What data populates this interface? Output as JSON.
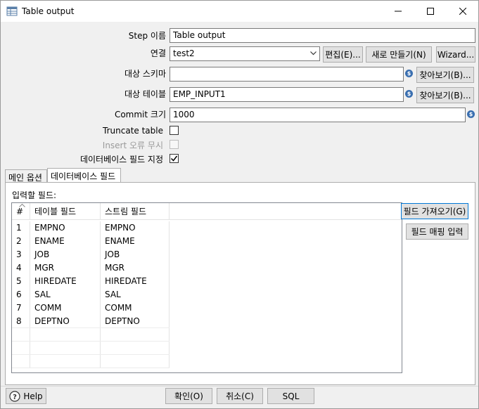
{
  "window": {
    "title": "Table output",
    "controls": {
      "minimize": "minimize",
      "maximize": "maximize",
      "close": "close"
    }
  },
  "form": {
    "step_name": {
      "label": "Step 이름",
      "value": "Table output"
    },
    "connection": {
      "label": "연결",
      "value": "test2",
      "edit_button": "편집(E)...",
      "new_button": "새로 만들기(N)",
      "wizard_button": "Wizard..."
    },
    "target_schema": {
      "label": "대상 스키마",
      "value": "",
      "browse_button": "찾아보기(B)..."
    },
    "target_table": {
      "label": "대상 테이블",
      "value": "EMP_INPUT1",
      "browse_button": "찾아보기(B)..."
    },
    "commit_size": {
      "label": "Commit 크기",
      "value": "1000"
    },
    "truncate_table": {
      "label": "Truncate table",
      "checked": false
    },
    "ignore_insert_errors": {
      "label": "Insert 오류 무시",
      "checked": false,
      "disabled": true
    },
    "specify_db_fields": {
      "label": "데이터베이스 필드 지정",
      "checked": true
    }
  },
  "tabs": [
    {
      "label": "메인 옵션",
      "active": false
    },
    {
      "label": "데이터베이스 필드",
      "active": true
    }
  ],
  "fields_panel": {
    "title": "입력할 필드:",
    "get_fields_button": "필드 가져오기(G)",
    "field_mapping_button": "필드 매핑 입력",
    "columns": [
      "#",
      "테이블 필드",
      "스트림 필드"
    ],
    "rows": [
      {
        "num": "1",
        "table_field": "EMPNO",
        "stream_field": "EMPNO"
      },
      {
        "num": "2",
        "table_field": "ENAME",
        "stream_field": "ENAME"
      },
      {
        "num": "3",
        "table_field": "JOB",
        "stream_field": "JOB"
      },
      {
        "num": "4",
        "table_field": "MGR",
        "stream_field": "MGR"
      },
      {
        "num": "5",
        "table_field": "HIREDATE",
        "stream_field": "HIREDATE"
      },
      {
        "num": "6",
        "table_field": "SAL",
        "stream_field": "SAL"
      },
      {
        "num": "7",
        "table_field": "COMM",
        "stream_field": "COMM"
      },
      {
        "num": "8",
        "table_field": "DEPTNO",
        "stream_field": "DEPTNO"
      }
    ]
  },
  "footer": {
    "help_button": "Help",
    "ok_button": "확인(O)",
    "cancel_button": "취소(C)",
    "sql_button": "SQL"
  },
  "colors": {
    "accent": "#0078d7",
    "variable_icon": "#3a6fb0"
  }
}
